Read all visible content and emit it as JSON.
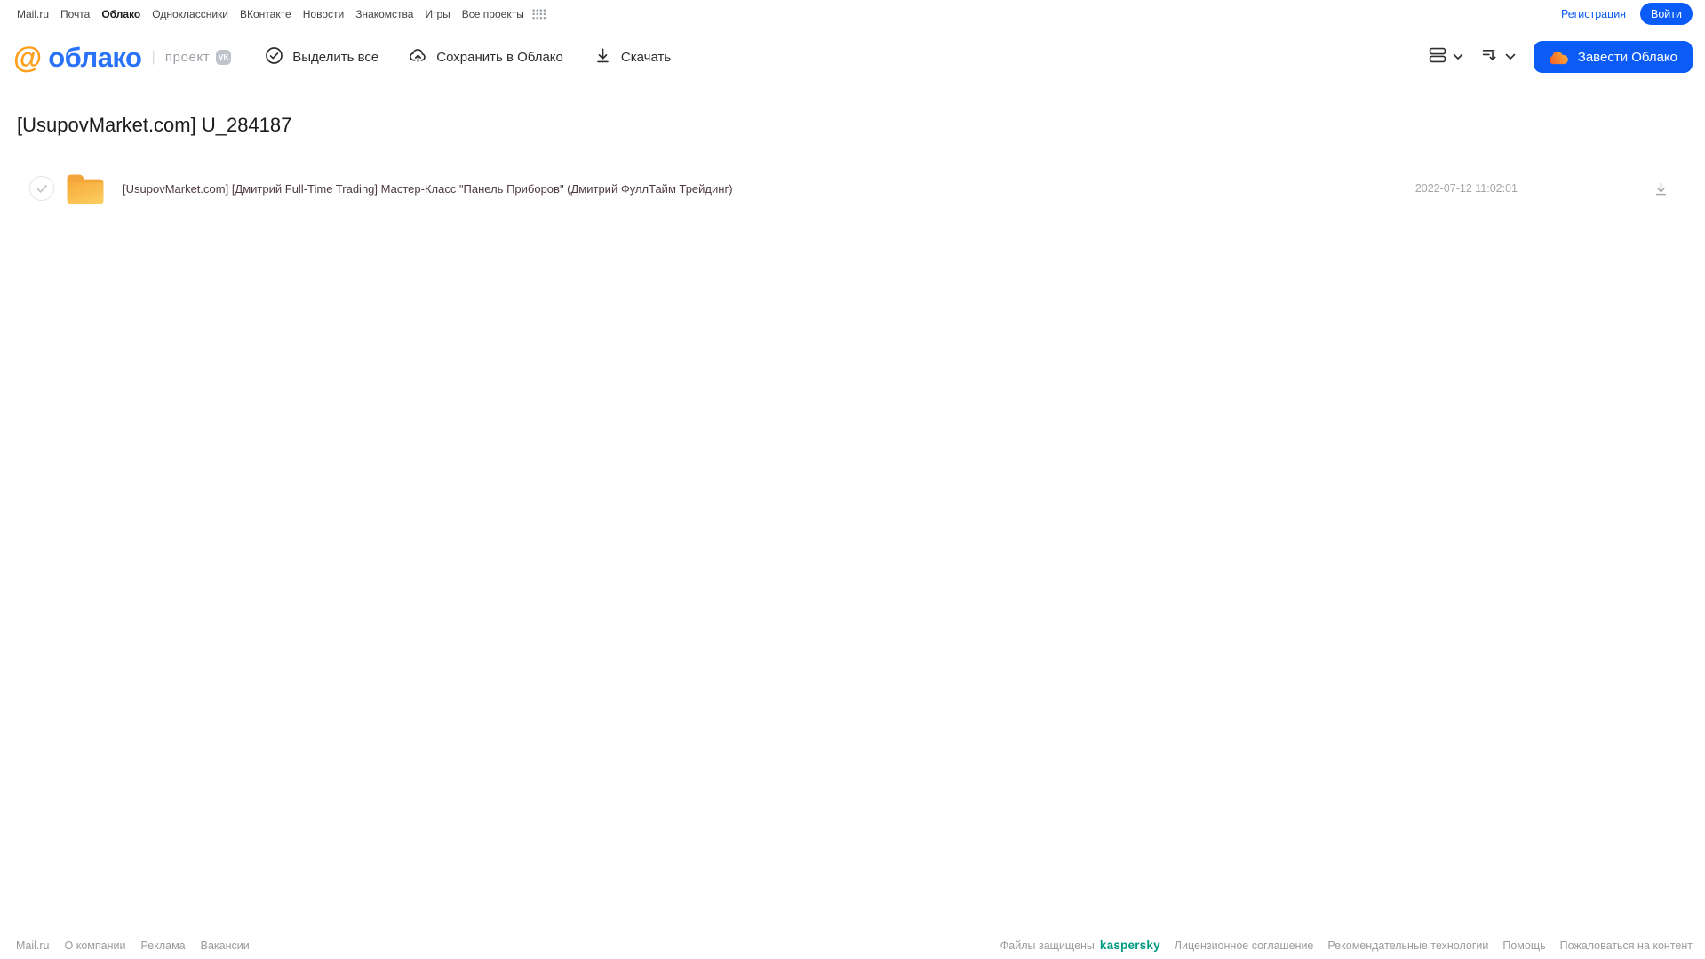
{
  "topnav": {
    "items": [
      {
        "label": "Mail.ru"
      },
      {
        "label": "Почта"
      },
      {
        "label": "Облако",
        "active": true
      },
      {
        "label": "Одноклассники"
      },
      {
        "label": "ВКонтакте"
      },
      {
        "label": "Новости"
      },
      {
        "label": "Знакомства"
      },
      {
        "label": "Игры"
      },
      {
        "label": "Все проекты"
      }
    ],
    "registration_label": "Регистрация",
    "login_label": "Войти"
  },
  "header": {
    "logo_at": "@",
    "logo_text": "облако",
    "project_label": "проект",
    "vk_badge": "VK",
    "toolbar": {
      "select_all": "Выделить все",
      "save_to_cloud": "Сохранить в Облако",
      "download": "Скачать"
    },
    "cta_label": "Завести Облако"
  },
  "content": {
    "title": "[UsupovMarket.com] U_284187",
    "files": [
      {
        "type": "folder",
        "name": "[UsupovMarket.com] [Дмитрий Full-Time Trading] Мастер-Класс \"Панель Приборов\" (Дмитрий ФуллТайм Трейдинг)",
        "modified": "2022-07-12 11:02:01"
      }
    ]
  },
  "footer": {
    "left_links": [
      {
        "label": "Mail.ru"
      },
      {
        "label": "О компании"
      },
      {
        "label": "Реклама"
      },
      {
        "label": "Вакансии"
      }
    ],
    "protected_label": "Файлы защищены",
    "kaspersky_label": "kaspersky",
    "right_links": [
      {
        "label": "Лицензионное соглашение"
      },
      {
        "label": "Рекомендательные технологии"
      },
      {
        "label": "Помощь"
      },
      {
        "label": "Пожаловаться на контент"
      }
    ]
  },
  "colors": {
    "brand_blue": "#0b5cf7",
    "logo_orange": "#ff9e1b",
    "kaspersky_green": "#009982",
    "folder_yellow": "#f8b847",
    "filename_color": "#4e3a44"
  }
}
